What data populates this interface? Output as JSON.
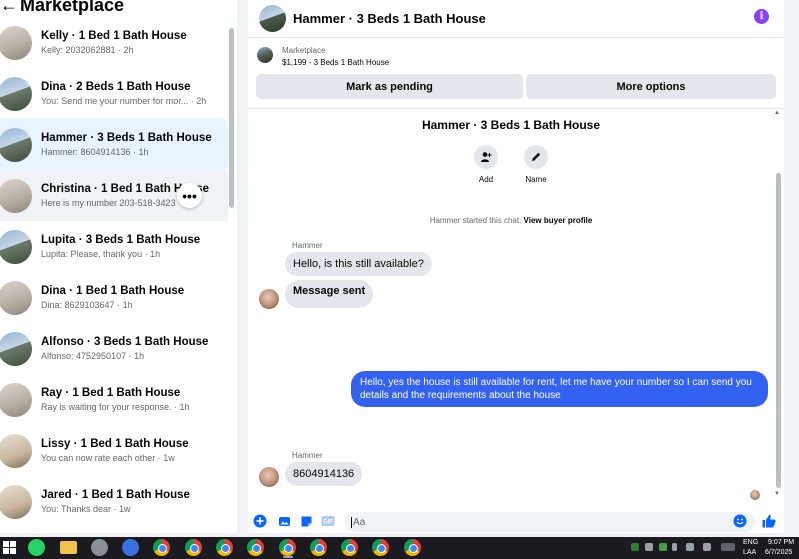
{
  "left": {
    "title": "Marketplace",
    "back_glyph": "←",
    "conversations": [
      {
        "title": "Kelly · 1 Bed 1 Bath House",
        "sub": "Kelly: 2032062881 · 2h",
        "thumb": "room"
      },
      {
        "title": "Dina · 2 Beds 1 Bath House",
        "sub": "You: Send me your number for mor... · 2h",
        "thumb": "house"
      },
      {
        "title": "Hammer · 3 Beds 1 Bath House",
        "sub": "Hammer: 8604914136 · 1h",
        "thumb": "house"
      },
      {
        "title": "Christina · 1 Bed 1 Bath House",
        "sub": "Here is my number 203-518-3423",
        "thumb": "room"
      },
      {
        "title": "Lupita · 3 Beds 1 Bath House",
        "sub": "Lupita: Please, thank you · 1h",
        "thumb": "house"
      },
      {
        "title": "Dina · 1 Bed 1 Bath House",
        "sub": "Dina: 8629103647 · 1h",
        "thumb": "room"
      },
      {
        "title": "Alfonso · 3 Beds 1 Bath House",
        "sub": "Alfonso: 4752950107 · 1h",
        "thumb": "house"
      },
      {
        "title": "Ray · 1 Bed 1 Bath House",
        "sub": "Ray is waiting for your response. · 1h",
        "thumb": "room"
      },
      {
        "title": "Lissy · 1 Bed 1 Bath House",
        "sub": "You can now rate each other · 1w",
        "thumb": "interior"
      },
      {
        "title": "Jared · 1 Bed 1 Bath House",
        "sub": "You: Thanks dear · 1w",
        "thumb": "interior"
      }
    ],
    "more_glyph": "•••"
  },
  "chat": {
    "header_title": "Hammer · 3 Beds 1 Bath House",
    "info_glyph": "i",
    "marketplace_label": "Marketplace",
    "listing": "$1,199 - 3 Beds 1 Bath House",
    "mark_pending": "Mark as pending",
    "more_options": "More options",
    "profile_name": "Hammer · 3 Beds 1 Bath House",
    "add_label": "Add",
    "name_label": "Name",
    "system_prefix": "Hammer started this chat.",
    "system_link": "View buyer profile",
    "messages": {
      "sender1": "Hammer",
      "msg1": "Hello, is this still available?",
      "msg2": "Message sent",
      "out1": "Hello, yes the house is still available for rent, let me have your number so I can send you details and the requirements about the house",
      "sender2": "Hammer",
      "msg3": "8604914136"
    },
    "composer_placeholder": "Aa"
  },
  "taskbar": {
    "lang": "ENG",
    "lang2": "LAA",
    "time": "9:07 PM",
    "date": "6/7/2025"
  },
  "colors": {
    "accent": "#3362f0",
    "active_row": "#e7f3ff",
    "info_purple": "#8a3ffc"
  }
}
